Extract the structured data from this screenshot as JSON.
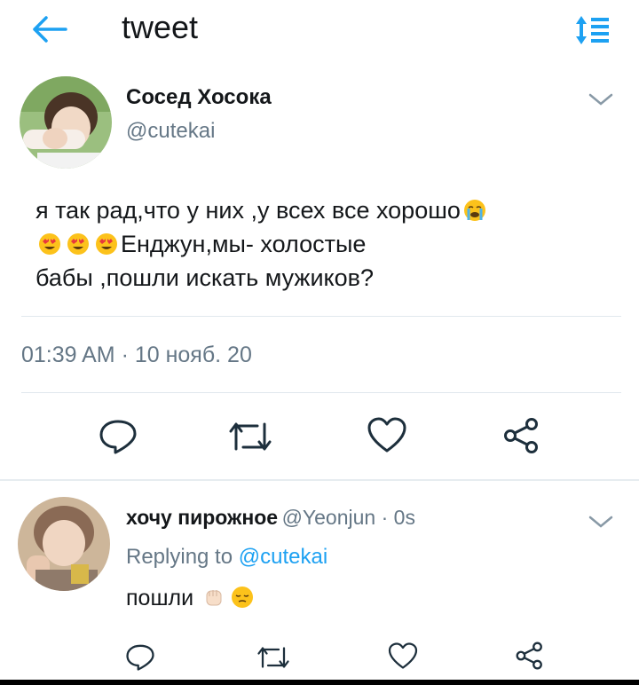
{
  "header": {
    "title": "tweet",
    "back_icon": "arrow-left-icon",
    "sort_icon": "sort-icon",
    "accent": "#1da1f2"
  },
  "tweet": {
    "author_name": "Сосед Хосока",
    "author_handle": "@cutekai",
    "text_line1": "я так рад,что у них ,у всех  все хорошо",
    "text_line2": "Енджун,мы- холостые",
    "text_line3": "бабы ,пошли искать мужиков?",
    "timestamp": "01:39 AM · 10 нояб. 20",
    "emojis": [
      "crying-face",
      "heart-eyes",
      "heart-eyes",
      "heart-eyes"
    ],
    "actions": [
      "reply-icon",
      "retweet-icon",
      "like-icon",
      "share-icon"
    ]
  },
  "reply": {
    "author_name": "хочу пирожное",
    "author_meta": "@Yeonjun · 0s",
    "replying_prefix": "Replying to",
    "replying_handle": "@cutekai",
    "text": "пошли",
    "emojis": [
      "raised-fist",
      "relieved-face"
    ],
    "actions": [
      "reply-icon",
      "retweet-icon",
      "like-icon",
      "share-icon"
    ]
  },
  "colors": {
    "text_primary": "#14171a",
    "text_secondary": "#657786",
    "divider": "#e1e8ed"
  }
}
